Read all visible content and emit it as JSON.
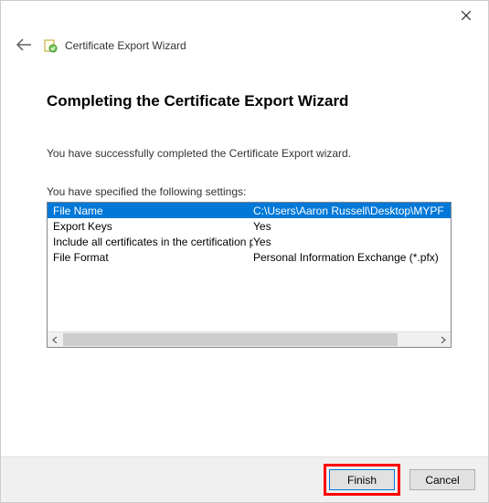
{
  "window": {
    "title": "Certificate Export Wizard"
  },
  "heading": "Completing the Certificate Export Wizard",
  "success_text": "You have successfully completed the Certificate Export wizard.",
  "settings_intro": "You have specified the following settings:",
  "settings": [
    {
      "label": "File Name",
      "value": "C:\\Users\\Aaron Russell\\Desktop\\MYPF"
    },
    {
      "label": "Export Keys",
      "value": "Yes"
    },
    {
      "label": "Include all certificates in the certification path",
      "value": "Yes"
    },
    {
      "label": "File Format",
      "value": "Personal Information Exchange (*.pfx)"
    }
  ],
  "buttons": {
    "finish": "Finish",
    "cancel": "Cancel"
  }
}
